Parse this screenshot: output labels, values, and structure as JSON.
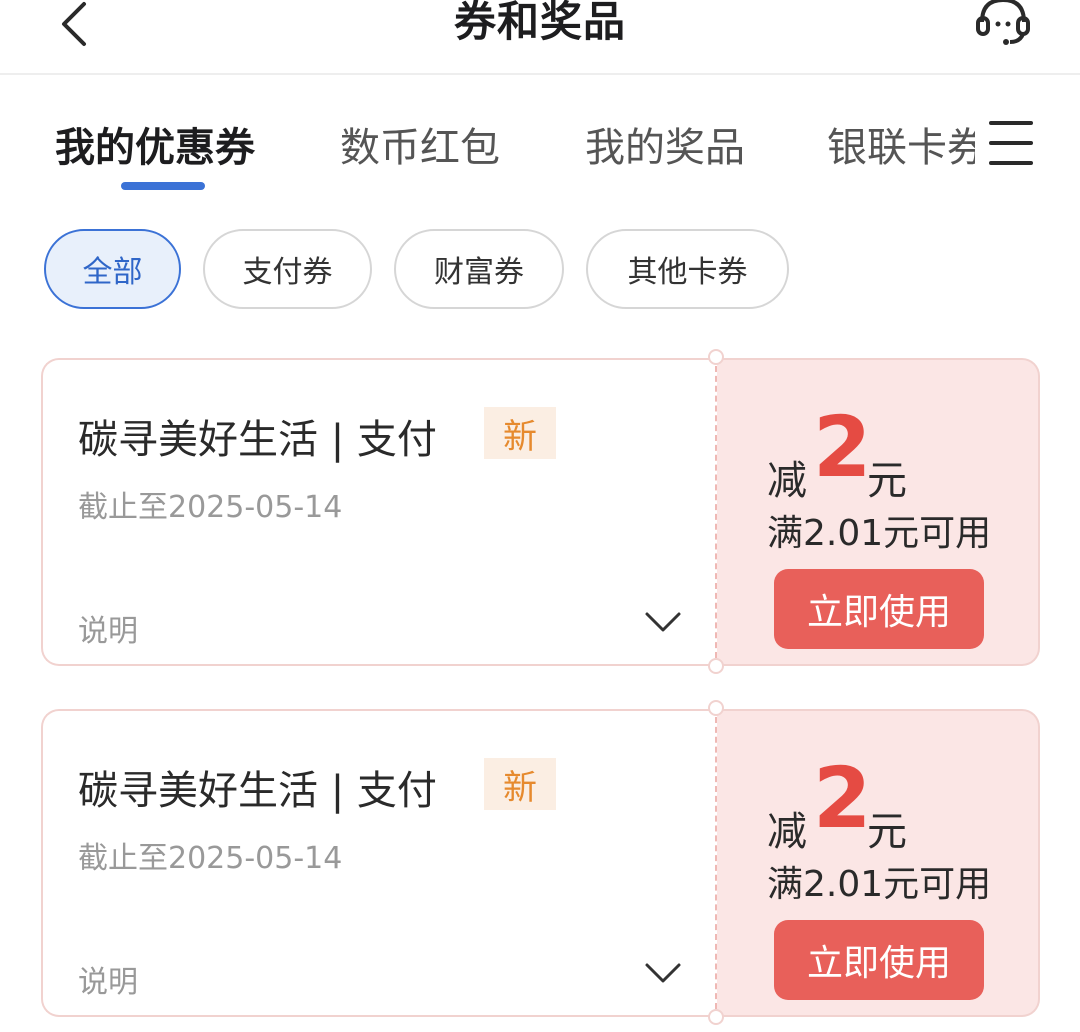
{
  "header": {
    "title": "券和奖品",
    "back_icon": "back-arrow-icon",
    "service_icon": "headset-icon"
  },
  "tabs": [
    {
      "label": "我的优惠券",
      "active": true
    },
    {
      "label": "数币红包",
      "active": false
    },
    {
      "label": "我的奖品",
      "active": false
    },
    {
      "label": "银联卡券",
      "active": false
    }
  ],
  "menu_icon": "menu-icon",
  "filters": [
    {
      "label": "全部",
      "active": true
    },
    {
      "label": "支付券",
      "active": false
    },
    {
      "label": "财富券",
      "active": false
    },
    {
      "label": "其他卡券",
      "active": false
    }
  ],
  "coupons": [
    {
      "title": "碳寻美好生活 | 支付",
      "badge": "新",
      "expiry": "截止至2025-05-14",
      "desc_label": "说明",
      "reduce_prefix": "减",
      "amount": "2",
      "unit": "元",
      "threshold": "满2.01元可用",
      "action": "立即使用"
    },
    {
      "title": "碳寻美好生活 | 支付",
      "badge": "新",
      "expiry": "截止至2025-05-14",
      "desc_label": "说明",
      "reduce_prefix": "减",
      "amount": "2",
      "unit": "元",
      "threshold": "满2.01元可用",
      "action": "立即使用"
    }
  ],
  "colors": {
    "accent_blue": "#3b72d6",
    "coupon_red": "#e54b43",
    "button_red": "#e8605a",
    "badge_orange": "#e68a2e",
    "coupon_bg": "#fbe6e5"
  }
}
